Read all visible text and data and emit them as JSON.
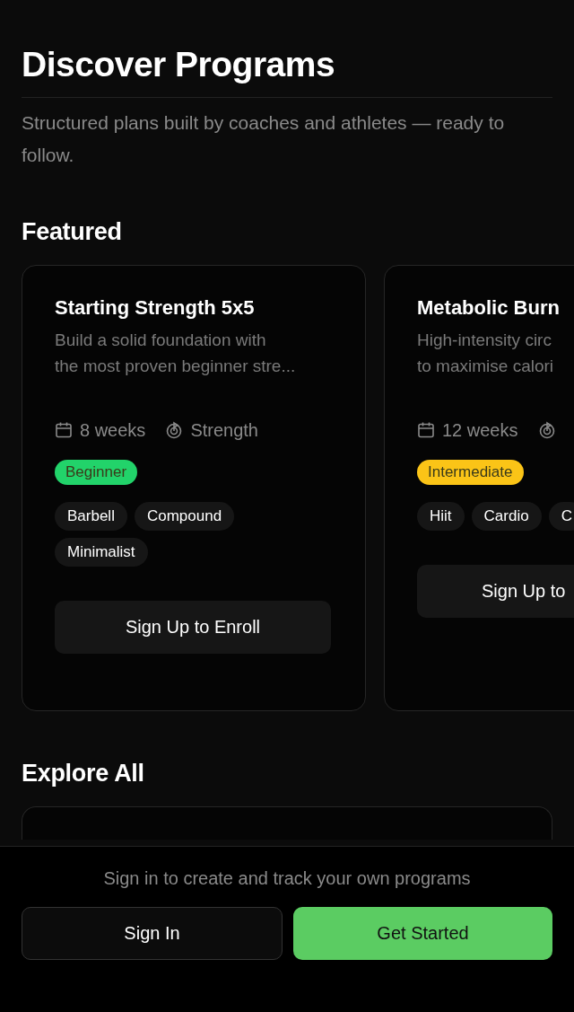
{
  "header": {
    "title": "Discover Programs",
    "subtitle": "Structured plans built by coaches and athletes — ready to follow."
  },
  "featured": {
    "heading": "Featured",
    "cards": [
      {
        "title": "Starting Strength 5x5",
        "description_lines": [
          "Build a solid foundation with",
          "the most proven beginner stre..."
        ],
        "duration": "8 weeks",
        "category": "Strength",
        "level": {
          "label": "Beginner",
          "color": "#22d36a"
        },
        "tags": [
          "Barbell",
          "Compound",
          "Minimalist"
        ],
        "button": "Sign Up to Enroll"
      },
      {
        "title": "Metabolic Burn",
        "description_lines": [
          "High-intensity circ",
          "to maximise calori"
        ],
        "duration": "12 weeks",
        "level": {
          "label": "Intermediate",
          "color": "#fbc417"
        },
        "tags": [
          "Hiit",
          "Cardio",
          "C"
        ],
        "button": "Sign Up to"
      }
    ]
  },
  "explore": {
    "heading": "Explore All"
  },
  "bottom_bar": {
    "prompt": "Sign in to create and track your own programs",
    "buttons": [
      {
        "label": "Sign In",
        "kind": "secondary"
      },
      {
        "label": "Get Started",
        "kind": "primary"
      }
    ]
  }
}
